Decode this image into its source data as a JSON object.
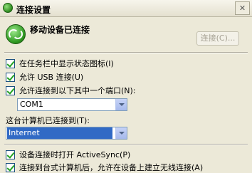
{
  "window": {
    "title": "连接设置",
    "close_glyph": "✕"
  },
  "status": {
    "text": "移动设备已连接"
  },
  "buttons": {
    "connect_label": "连接(C)..."
  },
  "options": {
    "show_status_icon": {
      "label": "在任务栏中显示状态图标(I)",
      "checked": true
    },
    "allow_usb": {
      "label": "允许 USB 连接(U)",
      "checked": true
    },
    "allow_port": {
      "label": "允许连接到以下其中一个端口(N):",
      "checked": true
    },
    "open_activesync": {
      "label": "设备连接时打开 ActiveSync(P)",
      "checked": true
    },
    "wireless_desktop": {
      "label": "连接到台式计算机后，允许在设备上建立无线连接(A)",
      "checked": true
    }
  },
  "port_select": {
    "value": "COM1"
  },
  "connection_label": "这台计算机已连接到(T):",
  "connection_select": {
    "value": "Internet"
  },
  "icons": {
    "title_icon": "sync-icon",
    "status_icon": "connected-sync-icon"
  }
}
